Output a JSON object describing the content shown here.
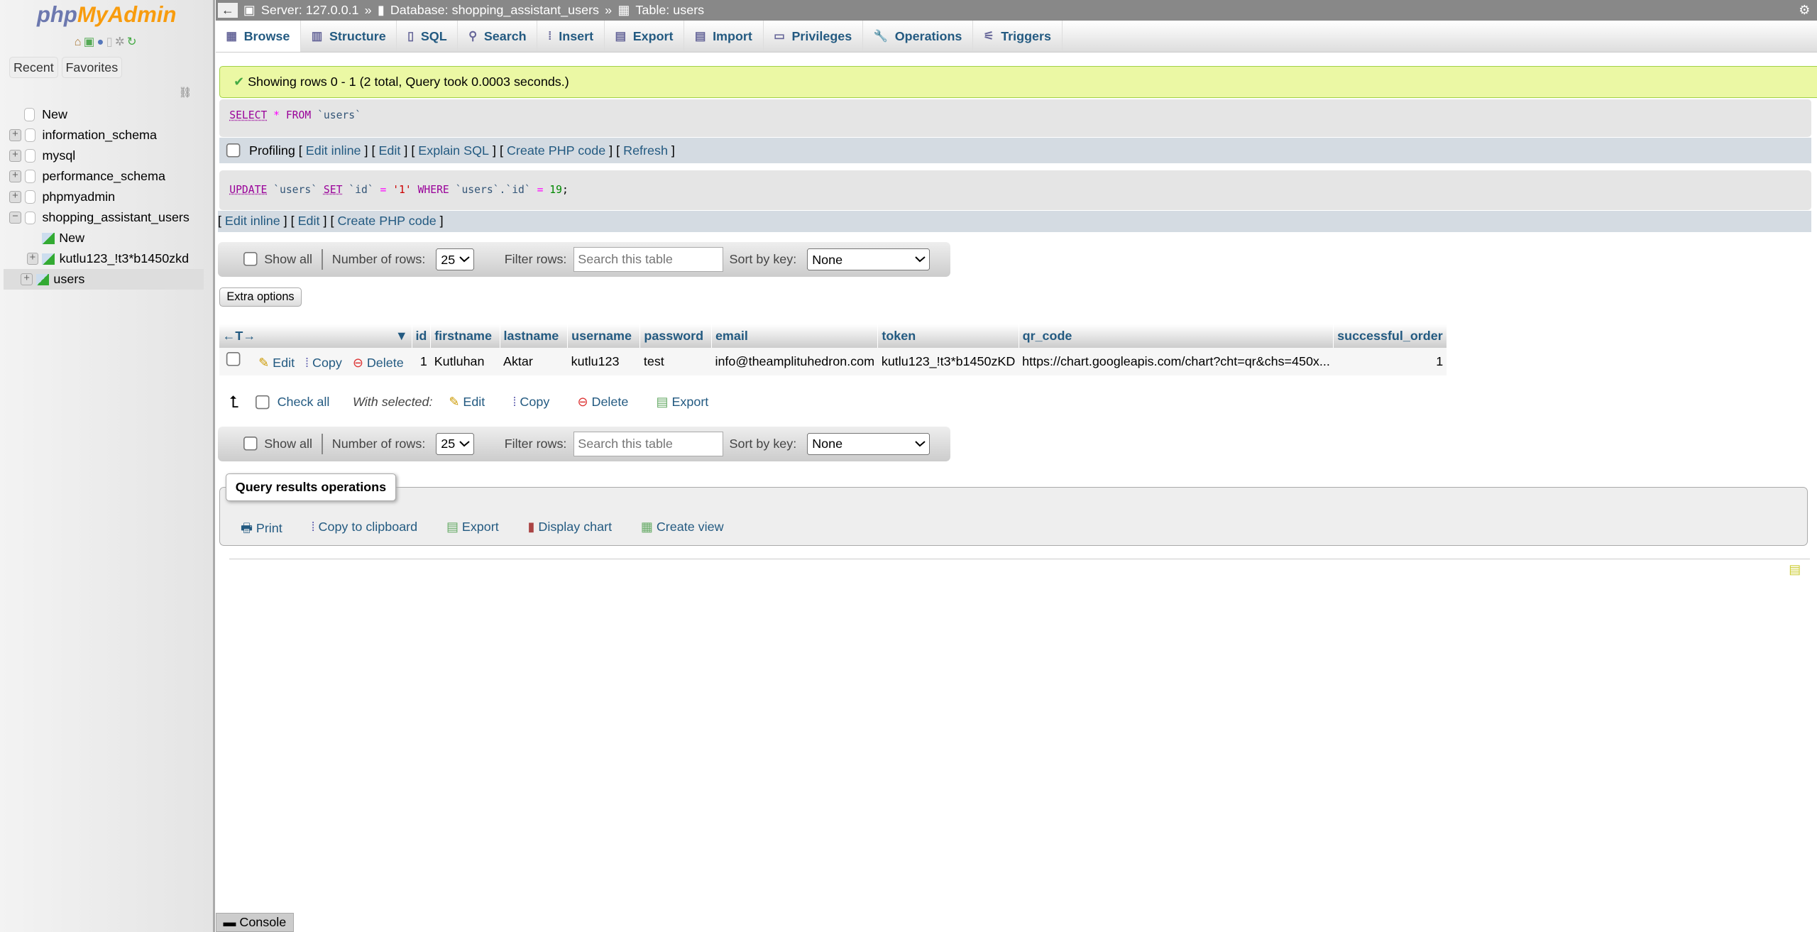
{
  "logo": {
    "php": "php",
    "my": "MyAdmin"
  },
  "sidebar": {
    "tabs": [
      "Recent",
      "Favorites"
    ],
    "tree": [
      "New",
      "information_schema",
      "mysql",
      "performance_schema",
      "phpmyadmin",
      "shopping_assistant_users",
      "New",
      "kutlu123_!t3*b1450zkd",
      "users"
    ]
  },
  "breadcrumb": {
    "server": "Server: 127.0.0.1",
    "database": "Database: shopping_assistant_users",
    "table": "Table: users",
    "sep": "»"
  },
  "tabs": [
    "Browse",
    "Structure",
    "SQL",
    "Search",
    "Insert",
    "Export",
    "Import",
    "Privileges",
    "Operations",
    "Triggers"
  ],
  "message": "Showing rows 0 - 1 (2 total, Query took 0.0003 seconds.)",
  "query1": {
    "select": "SELECT",
    "star": "*",
    "from": "FROM",
    "table": "`users`"
  },
  "query1_tools": {
    "profiling": "Profiling",
    "links": [
      "Edit inline",
      "Edit",
      "Explain SQL",
      "Create PHP code",
      "Refresh"
    ]
  },
  "query2": {
    "update": "UPDATE",
    "t": "`users`",
    "set": "SET",
    "col": "`id`",
    "eq": "=",
    "val": "'1'",
    "where": "WHERE",
    "t2": "`users`.`id`",
    "eq2": "=",
    "num": "19",
    ";": ";"
  },
  "query2_tools": [
    "Edit inline",
    "Edit",
    "Create PHP code"
  ],
  "nav": {
    "show_all": "Show all",
    "num_rows_label": "Number of rows:",
    "num_rows": "25",
    "filter_label": "Filter rows:",
    "filter_placeholder": "Search this table",
    "sort_label": "Sort by key:",
    "sort_value": "None"
  },
  "extra_options": "Extra options",
  "table": {
    "columns": [
      "id",
      "firstname",
      "lastname",
      "username",
      "password",
      "email",
      "token",
      "qr_code",
      "successful_order"
    ],
    "rows": [
      {
        "actions": [
          "Edit",
          "Copy",
          "Delete"
        ],
        "cells": [
          "1",
          "Kutluhan",
          "Aktar",
          "kutlu123",
          "test",
          "info@theamplituhedron.com",
          "kutlu123_!t3*b1450zKD",
          "https://chart.googleapis.com/chart?cht=qr&chs=450x...",
          "1"
        ]
      }
    ]
  },
  "bulk": {
    "check_all": "Check all",
    "with_selected": "With selected:",
    "actions": [
      "Edit",
      "Copy",
      "Delete",
      "Export"
    ]
  },
  "qro": {
    "title": "Query results operations",
    "ops": [
      "Print",
      "Copy to clipboard",
      "Export",
      "Display chart",
      "Create view"
    ]
  },
  "console": "Console"
}
